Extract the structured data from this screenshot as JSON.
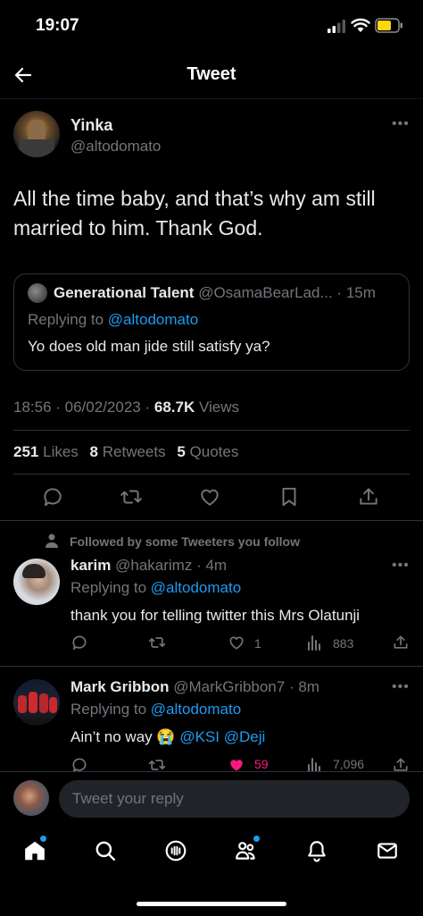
{
  "status_bar": {
    "time": "19:07"
  },
  "header": {
    "title": "Tweet"
  },
  "main_tweet": {
    "author_name": "Yinka",
    "author_handle": "@altodomato",
    "text": "All the time baby, and that’s why am still married to him.  Thank God.",
    "quote": {
      "author_name": "Generational Talent",
      "author_handle": "@OsamaBearLad...",
      "time": "15m",
      "replying_prefix": "Replying to",
      "replying_to": "@altodomato",
      "text": "Yo does old man jide still satisfy ya?"
    },
    "timestamp": "18:56 · 06/02/2023 ·",
    "views_count": "68.7K",
    "views_label": "Views",
    "stats": {
      "likes_count": "251",
      "likes_label": "Likes",
      "retweets_count": "8",
      "retweets_label": "Retweets",
      "quotes_count": "5",
      "quotes_label": "Quotes"
    }
  },
  "followed_notice": "Followed by some Tweeters you follow",
  "replies": [
    {
      "name": "karim",
      "handle": "@hakarimz",
      "time": "· 4m",
      "replying_prefix": "Replying to",
      "replying_to": "@altodomato",
      "text": "thank you for telling twitter this Mrs Olatunji",
      "likes": "1",
      "views": "883"
    },
    {
      "name": "Mark Gribbon",
      "handle": "@MarkGribbon7",
      "time": "· 8m",
      "replying_prefix": "Replying to",
      "replying_to": "@altodomato",
      "text_before": "Ain’t no way",
      "emoji": "😭",
      "mention1": "@KSI",
      "mention2": "@Deji",
      "likes": "59",
      "views": "7,096"
    }
  ],
  "reply_box": {
    "placeholder": "Tweet your reply"
  },
  "colors": {
    "accent": "#1d9bf0",
    "like_active": "#f91880",
    "muted": "#71767b"
  },
  "icons": [
    "back-arrow-icon",
    "more-icon",
    "reply-icon",
    "retweet-icon",
    "like-icon",
    "bookmark-icon",
    "share-icon",
    "views-icon",
    "person-icon",
    "home-icon",
    "search-icon",
    "spaces-icon",
    "communities-icon",
    "notifications-icon",
    "messages-icon"
  ]
}
